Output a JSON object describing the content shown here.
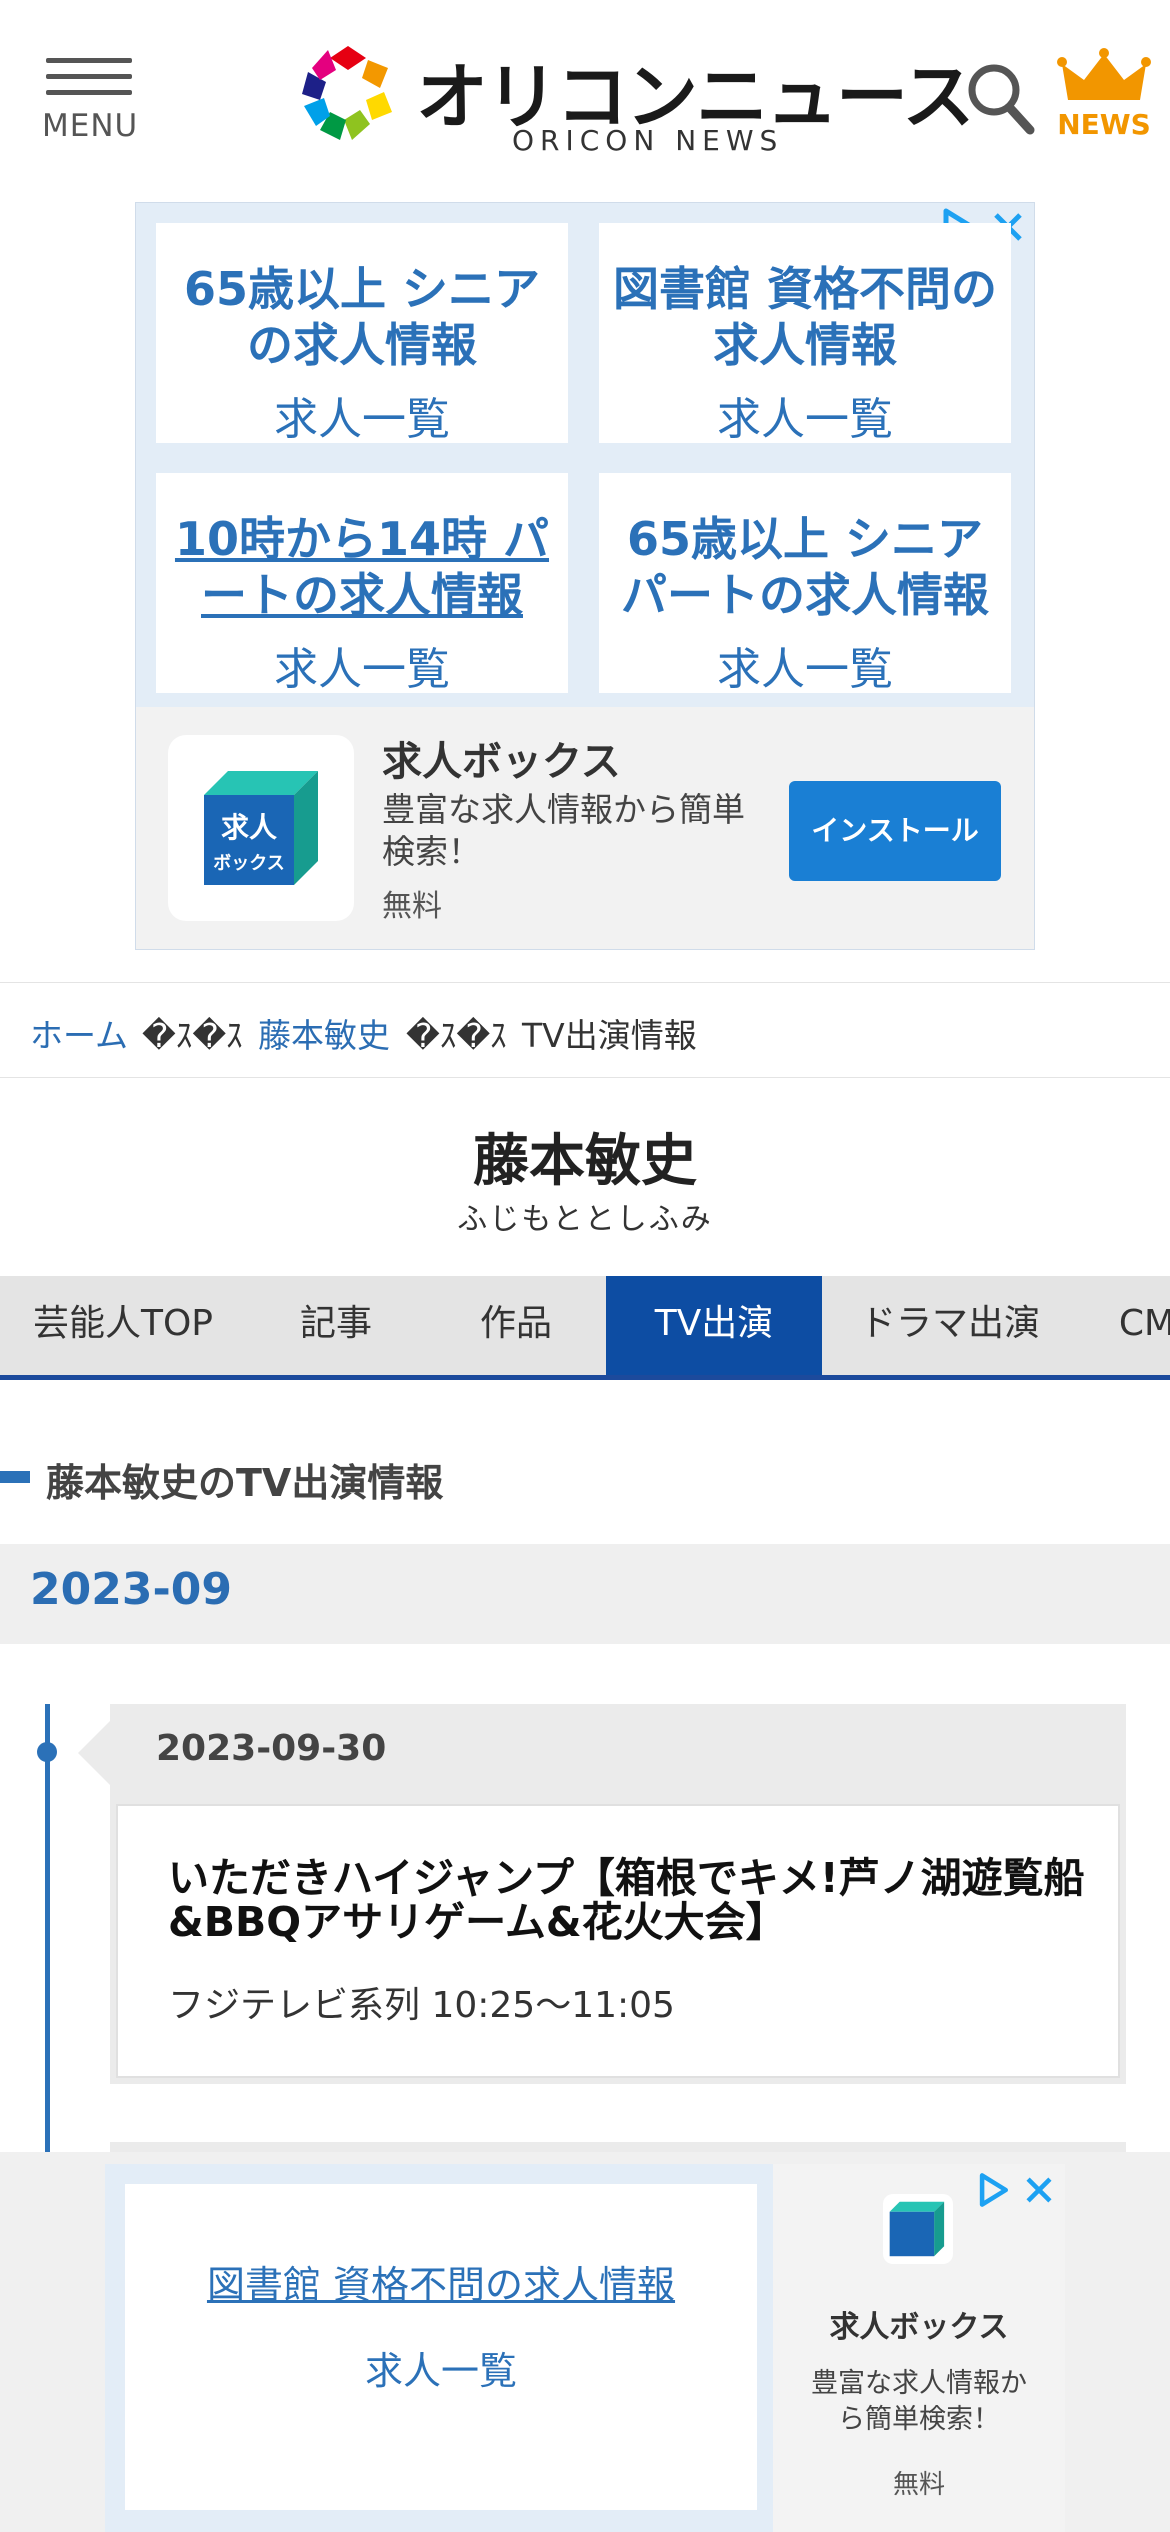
{
  "header": {
    "menu_label": "MENU",
    "logo_text_jp": "オリコンニュース",
    "logo_text_en": "ORICON NEWS",
    "news_label": "NEWS",
    "icons": [
      "menu-icon",
      "search-icon",
      "crown-icon"
    ]
  },
  "top_ad": {
    "cells": [
      {
        "title": "65歳以上 シニアの求人情報",
        "sub": "求人一覧"
      },
      {
        "title": "図書館 資格不問の求人情報",
        "sub": "求人一覧"
      },
      {
        "title": "10時から14時 パートの求人情報",
        "sub": "求人一覧"
      },
      {
        "title": "65歳以上 シニアパートの求人情報",
        "sub": "求人一覧"
      }
    ],
    "app": {
      "icon_text": "求人ボックス",
      "name": "求人ボックス",
      "desc": "豊富な求人情報から簡単検索！",
      "price": "無料",
      "install": "インストール"
    }
  },
  "breadcrumb": {
    "home": "ホーム",
    "sep": "�ｽ�ｽ",
    "person": "藤本敏史",
    "current": "TV出演情報"
  },
  "person": {
    "name": "藤本敏史",
    "kana": "ふじもととしふみ"
  },
  "tabs": [
    {
      "label": "芸能人TOP",
      "active": false
    },
    {
      "label": "記事",
      "active": false
    },
    {
      "label": "作品",
      "active": false
    },
    {
      "label": "TV出演",
      "active": true
    },
    {
      "label": "ドラマ出演",
      "active": false
    },
    {
      "label": "CM出演",
      "active": false
    }
  ],
  "section": {
    "title": "藤本敏史のTV出演情報",
    "month": "2023-09"
  },
  "entries": [
    {
      "date": "2023-09-30",
      "title": "いただきハイジャンプ【箱根でキメ!芦ノ湖遊覧船&BBQアサリゲーム&花火大会】",
      "meta": "フジテレビ系列 10:25〜11:05"
    }
  ],
  "bottom_ad": {
    "cell_title": "図書館 資格不問の求人情報",
    "cell_sub": "求人一覧",
    "app_name": "求人ボックス",
    "app_desc": "豊富な求人情報から簡単検索！",
    "app_price": "無料"
  },
  "colors": {
    "link": "#2b6db3",
    "tab_active": "#0d4da3",
    "accent_orange": "#f29600",
    "install_button": "#1a7fd4"
  }
}
